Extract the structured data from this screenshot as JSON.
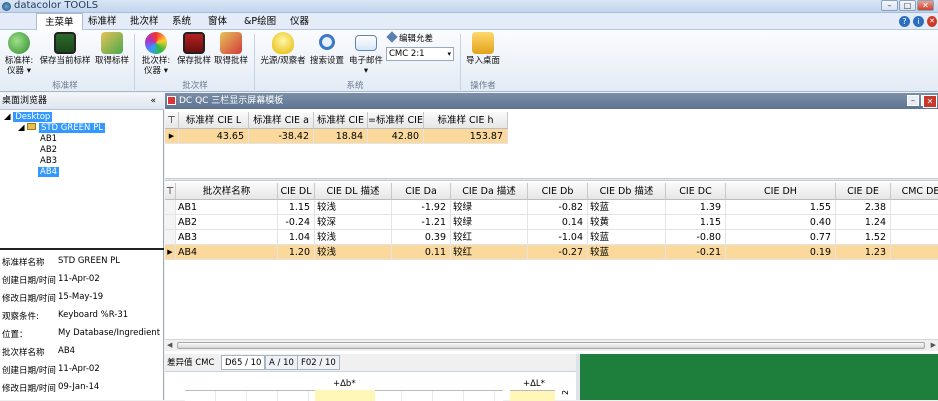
{
  "app": {
    "title": "datacolor TOOLS"
  },
  "menu": [
    "主菜单",
    "标准样",
    "批次样",
    "系统",
    "窗体",
    "&P绘图",
    "仪器"
  ],
  "ribbon": {
    "buttons": [
      {
        "label1": "标准样:",
        "label2": "仪器 ▾",
        "icon": "globe-green-icon"
      },
      {
        "label1": "保存当前标样",
        "label2": "",
        "icon": "floppy-green-icon"
      },
      {
        "label1": "取得标样",
        "label2": "",
        "icon": "retrieve-green-icon"
      },
      {
        "label1": "批次样:",
        "label2": "仪器 ▾",
        "icon": "color-swatch-icon"
      },
      {
        "label1": "保存批样",
        "label2": "",
        "icon": "floppy-red-icon"
      },
      {
        "label1": "取得批样",
        "label2": "",
        "icon": "retrieve-red-icon"
      },
      {
        "label1": "光源/观察者",
        "label2": "",
        "icon": "lightbulb-icon"
      },
      {
        "label1": "搜索设置",
        "label2": "",
        "icon": "magnifier-icon"
      },
      {
        "label1": "电子邮件",
        "label2": "▾",
        "icon": "email-icon"
      },
      {
        "label1": "导入桌面",
        "label2": "",
        "icon": "folder-import-icon"
      }
    ],
    "edit_tolerance": "编辑允差",
    "tolerance_select": "CMC 2:1",
    "groups": [
      "标准样",
      "批次样",
      "系统",
      "操作者"
    ]
  },
  "browser": {
    "title": "桌面浏览器",
    "tree": [
      "Desktop",
      "STD GREEN PL",
      "AB1",
      "AB2",
      "AB3",
      "AB4"
    ],
    "info": [
      {
        "label": "标准样名称",
        "value": "STD GREEN PL"
      },
      {
        "label": "创建日期/时间",
        "value": "11-Apr-02"
      },
      {
        "label": "修改日期/时间",
        "value": "15-May-19"
      },
      {
        "label": "观察条件:",
        "value": "Keyboard %R-31"
      },
      {
        "label": "位置：",
        "value": "My Database/Ingredient S"
      },
      {
        "label": "批次样名称",
        "value": "AB4"
      },
      {
        "label": "创建日期/时间",
        "value": "11-Apr-02"
      },
      {
        "label": "修改日期/时间",
        "value": "09-Jan-14"
      }
    ]
  },
  "qc": {
    "title": "DC QC 三栏显示屏幕模板",
    "std_headers": [
      "标准样 CIE L",
      "标准样 CIE a",
      "标准样 CIE b",
      "=标准样 CIE",
      "标准样 CIE h"
    ],
    "std_values": [
      "43.65",
      "-38.42",
      "18.84",
      "42.80",
      "153.87"
    ],
    "batch_headers": [
      "批次样名称",
      "CIE DL",
      "CIE DL 描述",
      "CIE Da",
      "CIE Da 描述",
      "CIE Db",
      "CIE Db 描述",
      "CIE DC",
      "CIE DH",
      "CIE DE",
      "CMC DE"
    ],
    "rows": [
      [
        "AB1",
        "1.15",
        "较浅",
        "-1.92",
        "较绿",
        "-0.82",
        "较蓝",
        "1.39",
        "1.55",
        "2.38",
        ""
      ],
      [
        "AB2",
        "-0.24",
        "较深",
        "-1.21",
        "较绿",
        "0.14",
        "较黄",
        "1.15",
        "0.40",
        "1.24",
        ""
      ],
      [
        "AB3",
        "1.04",
        "较浅",
        "0.39",
        "较红",
        "-1.04",
        "较蓝",
        "-0.80",
        "0.77",
        "1.52",
        ""
      ],
      [
        "AB4",
        "1.20",
        "较浅",
        "0.11",
        "较红",
        "-0.27",
        "较蓝",
        "-0.21",
        "0.19",
        "1.23",
        ""
      ]
    ]
  },
  "tabs": [
    "差异值 CMC",
    "D65 / 10",
    "A / 10",
    "F02 / 10"
  ],
  "chart": {
    "db_label": "+Δb*",
    "dl_label": "+ΔL*",
    "side_num": "2"
  },
  "colors": {
    "highlight": "#fbd99c",
    "green_patch": "#1e7f3c",
    "selection": "#3399ff"
  }
}
